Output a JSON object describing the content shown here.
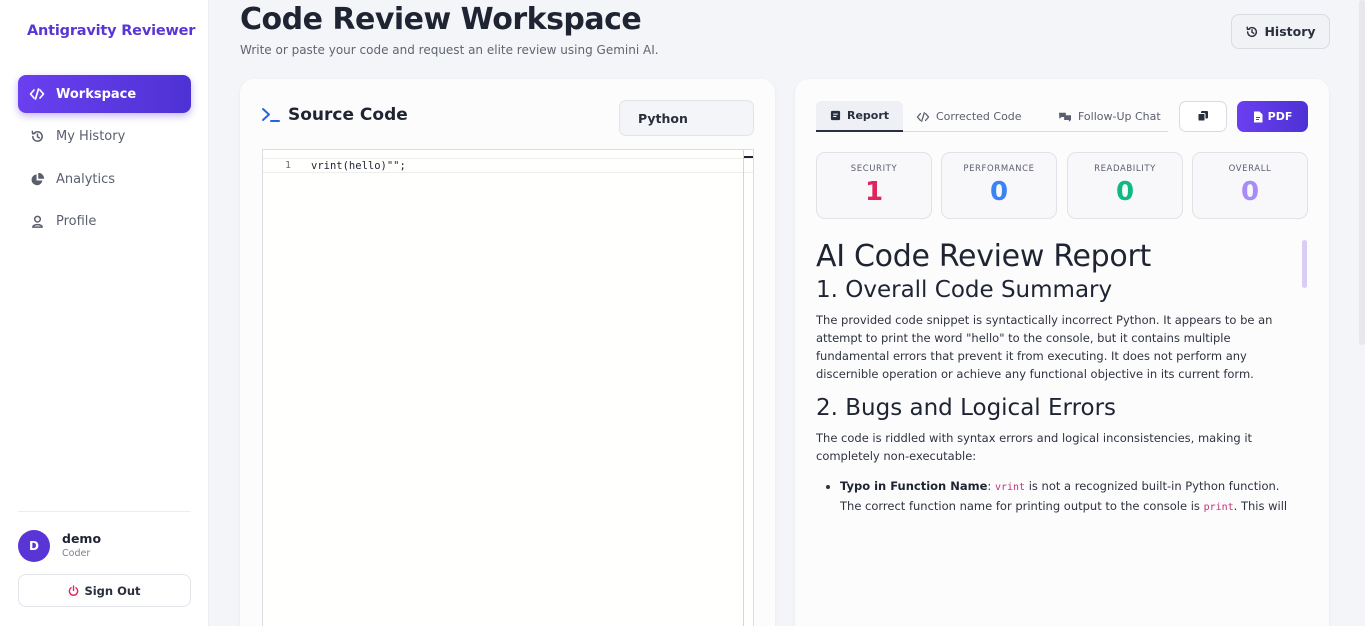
{
  "sidebar": {
    "brand": "Antigravity Reviewer",
    "items": [
      {
        "label": "Workspace",
        "icon": "code-icon"
      },
      {
        "label": "My History",
        "icon": "history-icon"
      },
      {
        "label": "Analytics",
        "icon": "pie-chart-icon"
      },
      {
        "label": "Profile",
        "icon": "user-icon"
      }
    ],
    "user": {
      "initial": "D",
      "name": "demo",
      "role": "Coder"
    },
    "signout_label": "Sign Out"
  },
  "header": {
    "title": "Code Review Workspace",
    "subtitle": "Write or paste your code and request an elite review using Gemini AI.",
    "history_label": "History"
  },
  "source": {
    "title": "Source Code",
    "language": "Python",
    "lines": [
      {
        "number": "1",
        "text": "vrint(hello)\"\";"
      }
    ]
  },
  "review": {
    "tabs": [
      "Report",
      "Corrected Code",
      "Follow-Up Chat"
    ],
    "pdf_label": "PDF",
    "metrics": [
      {
        "label": "SECURITY",
        "value": "1",
        "color": "#e0245e"
      },
      {
        "label": "PERFORMANCE",
        "value": "0",
        "color": "#3b82f6"
      },
      {
        "label": "READABILITY",
        "value": "0",
        "color": "#10b981"
      },
      {
        "label": "OVERALL",
        "value": "0",
        "color": "#a78bfa"
      }
    ],
    "report": {
      "h1": "AI Code Review Report",
      "s1_title": "1. Overall Code Summary",
      "s1_text": "The provided code snippet is syntactically incorrect Python. It appears to be an attempt to print the word \"hello\" to the console, but it contains multiple fundamental errors that prevent it from executing. It does not perform any discernible operation or achieve any functional objective in its current form.",
      "s2_title": "2. Bugs and Logical Errors",
      "s2_text": "The code is riddled with syntax errors and logical inconsistencies, making it completely non-executable:",
      "bullet1": {
        "bold": "Typo in Function Name",
        "colon": ":",
        "code1": "vrint",
        "text1": " is not a recognized built-in Python function. The correct function name for printing output to the console is ",
        "code2": "print",
        "text2": ". This will"
      }
    }
  }
}
